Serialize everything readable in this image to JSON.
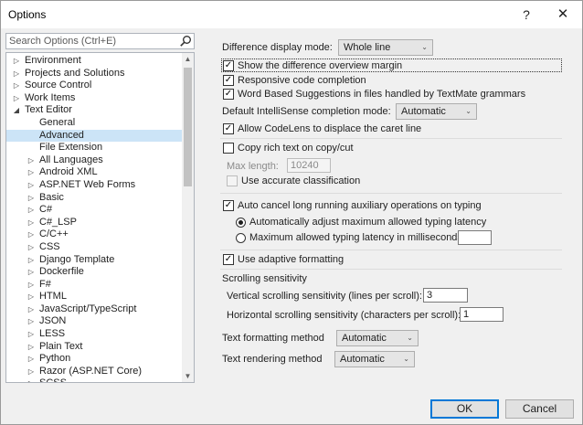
{
  "window": {
    "title": "Options",
    "help_label": "?",
    "close_label": "✕"
  },
  "search": {
    "placeholder": "Search Options (Ctrl+E)"
  },
  "tree": {
    "items": [
      {
        "label": "Environment",
        "level": 0,
        "arrow": "▷"
      },
      {
        "label": "Projects and Solutions",
        "level": 0,
        "arrow": "▷"
      },
      {
        "label": "Source Control",
        "level": 0,
        "arrow": "▷"
      },
      {
        "label": "Work Items",
        "level": 0,
        "arrow": "▷"
      },
      {
        "label": "Text Editor",
        "level": 0,
        "arrow": "◢"
      },
      {
        "label": "General",
        "level": 1,
        "arrow": ""
      },
      {
        "label": "Advanced",
        "level": 1,
        "arrow": "",
        "selected": true
      },
      {
        "label": "File Extension",
        "level": 1,
        "arrow": ""
      },
      {
        "label": "All Languages",
        "level": 1,
        "arrow": "▷"
      },
      {
        "label": "Android XML",
        "level": 1,
        "arrow": "▷"
      },
      {
        "label": "ASP.NET Web Forms",
        "level": 1,
        "arrow": "▷"
      },
      {
        "label": "Basic",
        "level": 1,
        "arrow": "▷"
      },
      {
        "label": "C#",
        "level": 1,
        "arrow": "▷"
      },
      {
        "label": "C#_LSP",
        "level": 1,
        "arrow": "▷"
      },
      {
        "label": "C/C++",
        "level": 1,
        "arrow": "▷"
      },
      {
        "label": "CSS",
        "level": 1,
        "arrow": "▷"
      },
      {
        "label": "Django Template",
        "level": 1,
        "arrow": "▷"
      },
      {
        "label": "Dockerfile",
        "level": 1,
        "arrow": "▷"
      },
      {
        "label": "F#",
        "level": 1,
        "arrow": "▷"
      },
      {
        "label": "HTML",
        "level": 1,
        "arrow": "▷"
      },
      {
        "label": "JavaScript/TypeScript",
        "level": 1,
        "arrow": "▷"
      },
      {
        "label": "JSON",
        "level": 1,
        "arrow": "▷"
      },
      {
        "label": "LESS",
        "level": 1,
        "arrow": "▷"
      },
      {
        "label": "Plain Text",
        "level": 1,
        "arrow": "▷"
      },
      {
        "label": "Python",
        "level": 1,
        "arrow": "▷"
      },
      {
        "label": "Razor (ASP.NET Core)",
        "level": 1,
        "arrow": "▷"
      },
      {
        "label": "SCSS",
        "level": 1,
        "arrow": "▷"
      }
    ]
  },
  "settings": {
    "diff_mode_label": "Difference display mode:",
    "diff_mode_value": "Whole line",
    "show_diff_margin": "Show the difference overview margin",
    "responsive_completion": "Responsive code completion",
    "word_suggestions": "Word Based Suggestions in files handled by TextMate grammars",
    "intellisense_label": "Default IntelliSense completion mode:",
    "intellisense_value": "Automatic",
    "codelens": "Allow CodeLens to displace the caret line",
    "copy_rich": "Copy rich text on copy/cut",
    "max_length_label": "Max length:",
    "max_length_value": "10240",
    "accurate_class": "Use accurate classification",
    "auto_cancel": "Auto cancel long running auxiliary operations on typing",
    "auto_adjust": "Automatically adjust maximum allowed typing latency",
    "max_latency": "Maximum allowed typing latency in milliseconds:",
    "adaptive": "Use adaptive formatting",
    "scroll_header": "Scrolling sensitivity",
    "vscroll_label": "Vertical scrolling sensitivity (lines per scroll):",
    "vscroll_value": "3",
    "hscroll_label": "Horizontal scrolling sensitivity (characters per scroll):",
    "hscroll_value": "1",
    "text_format_label": "Text formatting method",
    "text_format_value": "Automatic",
    "text_render_label": "Text rendering method",
    "text_render_value": "Automatic"
  },
  "buttons": {
    "ok": "OK",
    "cancel": "Cancel"
  },
  "icons": {
    "check": "✓",
    "chevron": "⌄",
    "search": "search-icon"
  }
}
